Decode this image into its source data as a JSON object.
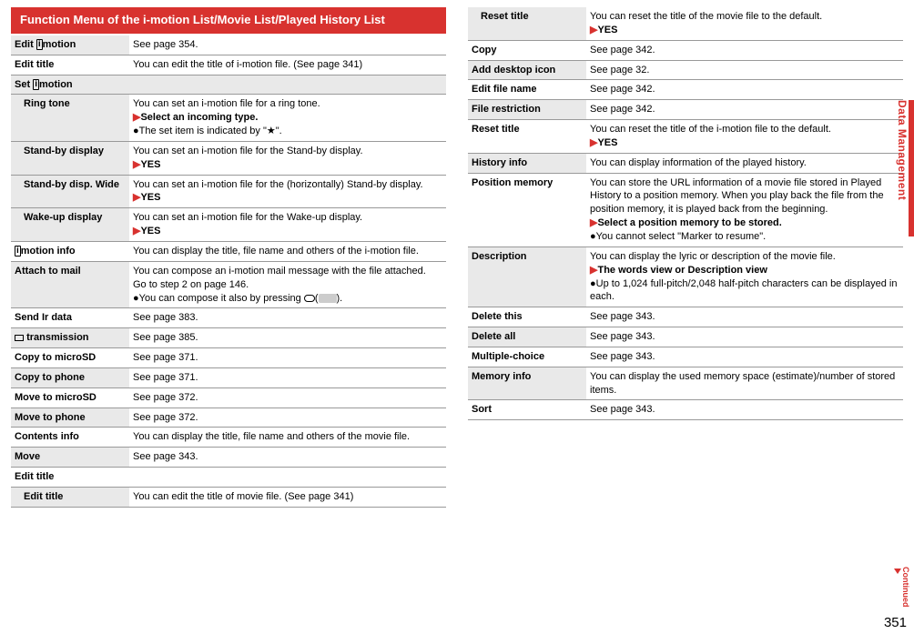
{
  "header": "Function Menu of the i-motion List/Movie List/Played History List",
  "sideTab": "Data Management",
  "continued": "Continued",
  "pageNum": "351",
  "left": {
    "editMotion": {
      "l": "Edit",
      "g": "i",
      "l2": "motion",
      "d": "See page 354."
    },
    "editTitle": {
      "l": "Edit title",
      "d": "You can edit the title of i-motion file. (See page 341)"
    },
    "setMotion": {
      "l": "Set",
      "g": "i",
      "l2": "motion"
    },
    "ringTone": {
      "l": "Ring tone",
      "d1": "You can set an i-motion file for a ring tone.",
      "d2": "Select an incoming type.",
      "d3": "●The set item is indicated by \"★\"."
    },
    "standby": {
      "l": "Stand-by display",
      "d1": "You can set an i-motion file for the Stand-by display.",
      "d2": "YES"
    },
    "standbyWide": {
      "l": "Stand-by disp. Wide",
      "d1": "You can set an i-motion file for the (horizontally) Stand-by display.",
      "d2": "YES"
    },
    "wakeup": {
      "l": "Wake-up display",
      "d1": "You can set an i-motion file for the Wake-up display.",
      "d2": "YES"
    },
    "motionInfo": {
      "g": "i",
      "l": "motion info",
      "d": "You can display the title, file name and others of the i-motion file."
    },
    "attach": {
      "l": "Attach to mail",
      "d1": "You can compose an i-motion mail message with the file attached.",
      "d2": "Go to step 2 on page 146.",
      "d3a": "●You can compose it also by pressing ",
      "d3b": "(",
      "d3c": ")."
    },
    "sendIr": {
      "l": "Send Ir data",
      "d": "See page 383."
    },
    "trans": {
      "l": "transmission",
      "d": "See page 385."
    },
    "copyMicro": {
      "l": "Copy to microSD",
      "d": "See page 371."
    },
    "copyPhone": {
      "l": "Copy to phone",
      "d": "See page 371."
    },
    "moveMicro": {
      "l": "Move to microSD",
      "d": "See page 372."
    },
    "movePhone": {
      "l": "Move to phone",
      "d": "See page 372."
    },
    "contents": {
      "l": "Contents info",
      "d": "You can display the title, file name and others of the movie file."
    },
    "move": {
      "l": "Move",
      "d": "See page 343."
    },
    "editTitleHdr": {
      "l": "Edit title"
    },
    "editTitleSub": {
      "l": "Edit title",
      "d": "You can edit the title of movie file. (See page 341)"
    }
  },
  "right": {
    "resetMovie": {
      "l": "Reset title",
      "d1": "You can reset the title of the movie file to the default.",
      "d2": "YES"
    },
    "copy": {
      "l": "Copy",
      "d": "See page 342."
    },
    "addIcon": {
      "l": "Add desktop icon",
      "d": "See page 32."
    },
    "editFile": {
      "l": "Edit file name",
      "d": "See page 342."
    },
    "fileRes": {
      "l": "File restriction",
      "d": "See page 342."
    },
    "resetI": {
      "l": "Reset title",
      "d1": "You can reset the title of the i-motion file to the default.",
      "d2": "YES"
    },
    "history": {
      "l": "History info",
      "d": "You can display information of the played history."
    },
    "position": {
      "l": "Position memory",
      "d1": "You can store the URL information of a movie file stored in Played History to a position memory. When you play back the file from the position memory, it is played back from the beginning.",
      "d2": "Select a position memory to be stored.",
      "d3": "●You cannot select \"Marker to resume\"."
    },
    "description": {
      "l": "Description",
      "d1": "You can display the lyric or description of the movie file.",
      "d2": "The words view or Description view",
      "d3": "●Up to 1,024 full-pitch/2,048 half-pitch characters can be displayed in each."
    },
    "deleteThis": {
      "l": "Delete this",
      "d": "See page 343."
    },
    "deleteAll": {
      "l": "Delete all",
      "d": "See page 343."
    },
    "multiple": {
      "l": "Multiple-choice",
      "d": "See page 343."
    },
    "memory": {
      "l": "Memory info",
      "d": "You can display the used memory space (estimate)/number of stored items."
    },
    "sort": {
      "l": "Sort",
      "d": "See page 343."
    }
  }
}
